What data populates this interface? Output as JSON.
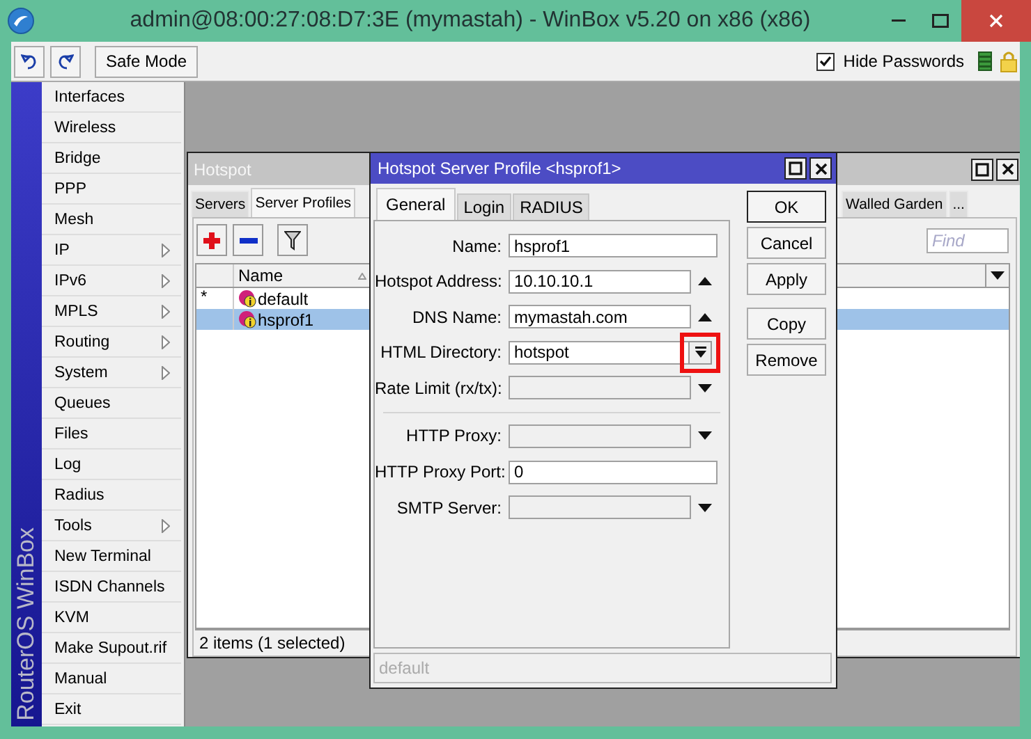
{
  "window": {
    "title": "admin@08:00:27:08:D7:3E (mymastah) - WinBox v5.20 on x86 (x86)"
  },
  "toolbar": {
    "safe_mode": "Safe Mode",
    "hide_passwords": {
      "label": "Hide Passwords",
      "checked": true
    }
  },
  "sidebar": {
    "brand": "RouterOS WinBox",
    "items": [
      {
        "label": "Interfaces",
        "submenu": false
      },
      {
        "label": "Wireless",
        "submenu": false
      },
      {
        "label": "Bridge",
        "submenu": false
      },
      {
        "label": "PPP",
        "submenu": false
      },
      {
        "label": "Mesh",
        "submenu": false
      },
      {
        "label": "IP",
        "submenu": true
      },
      {
        "label": "IPv6",
        "submenu": true
      },
      {
        "label": "MPLS",
        "submenu": true
      },
      {
        "label": "Routing",
        "submenu": true
      },
      {
        "label": "System",
        "submenu": true
      },
      {
        "label": "Queues",
        "submenu": false
      },
      {
        "label": "Files",
        "submenu": false
      },
      {
        "label": "Log",
        "submenu": false
      },
      {
        "label": "Radius",
        "submenu": false
      },
      {
        "label": "Tools",
        "submenu": true
      },
      {
        "label": "New Terminal",
        "submenu": false
      },
      {
        "label": "ISDN Channels",
        "submenu": false
      },
      {
        "label": "KVM",
        "submenu": false
      },
      {
        "label": "Make Supout.rif",
        "submenu": false
      },
      {
        "label": "Manual",
        "submenu": false
      },
      {
        "label": "Exit",
        "submenu": false
      }
    ]
  },
  "hotspot_window": {
    "title": "Hotspot",
    "tabs": [
      {
        "label": "Servers",
        "selected": false
      },
      {
        "label": "Server Profiles",
        "selected": true
      },
      {
        "label": "Walled Garden",
        "selected": false
      },
      {
        "label": "...",
        "selected": false
      }
    ],
    "find": {
      "placeholder": "Find"
    },
    "columns": [
      "Name"
    ],
    "rows": [
      {
        "flag": "*",
        "name": "default",
        "selected": false
      },
      {
        "name": "hsprof1",
        "selected": true
      }
    ],
    "status": "2 items (1 selected)"
  },
  "profile_dialog": {
    "title": "Hotspot Server Profile <hsprof1>",
    "tabs": [
      {
        "label": "General",
        "selected": true
      },
      {
        "label": "Login",
        "selected": false
      },
      {
        "label": "RADIUS",
        "selected": false
      }
    ],
    "fields": [
      {
        "kind": "text",
        "label": "Name:",
        "value": "hsprof1",
        "highlighted": false
      },
      {
        "kind": "optional",
        "label": "Hotspot Address:",
        "value": "10.10.10.1",
        "highlighted": false
      },
      {
        "kind": "optional",
        "label": "DNS Name:",
        "value": "mymastah.com",
        "highlighted": false
      },
      {
        "kind": "choice",
        "label": "HTML Directory:",
        "value": "hotspot",
        "highlighted": true
      },
      {
        "kind": "unset",
        "label": "Rate Limit (rx/tx):",
        "highlighted": false
      },
      {
        "kind": "separator"
      },
      {
        "kind": "unset",
        "label": "HTTP Proxy:",
        "highlighted": false
      },
      {
        "kind": "text",
        "label": "HTTP Proxy Port:",
        "value": "0",
        "highlighted": false
      },
      {
        "kind": "unset",
        "label": "SMTP Server:",
        "highlighted": false
      }
    ],
    "buttons": [
      "OK",
      "Cancel",
      "Apply",
      "Copy",
      "Remove"
    ],
    "status": "default"
  }
}
